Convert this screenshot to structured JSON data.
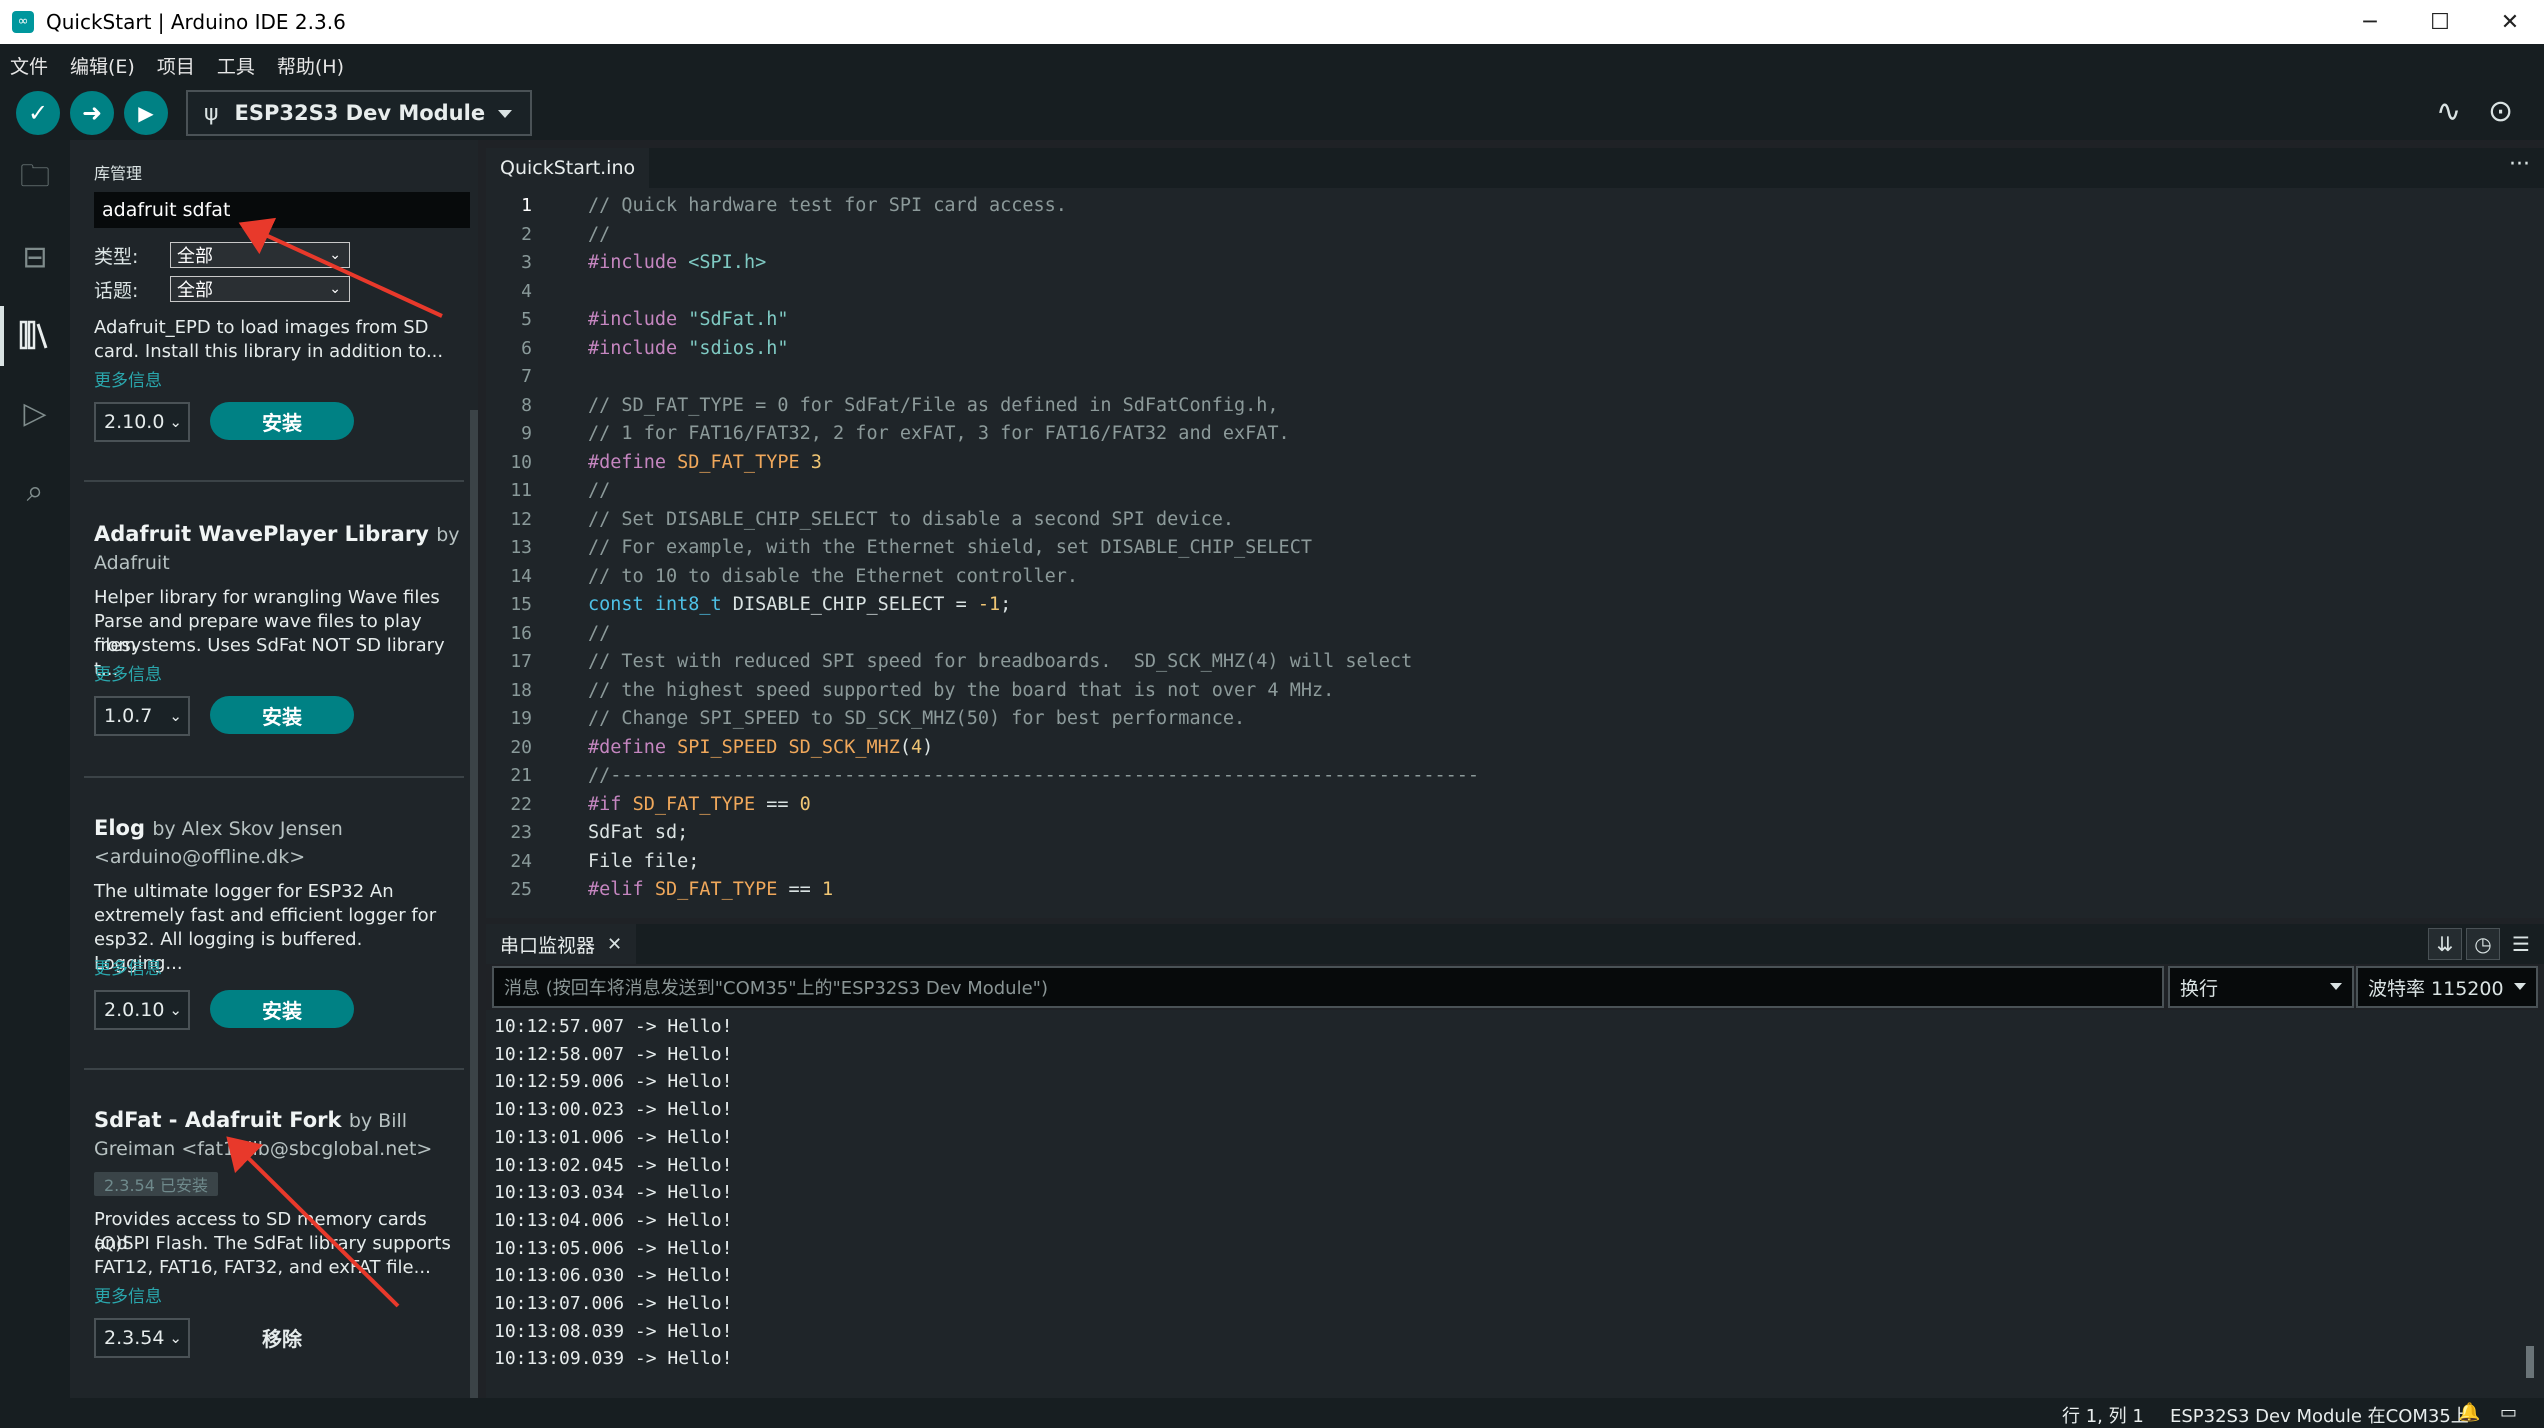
{
  "window": {
    "title": "QuickStart | Arduino IDE 2.3.6",
    "app_icon": "arduino-logo",
    "controls": [
      "minimize",
      "maximize",
      "close"
    ]
  },
  "menu": {
    "items": [
      "文件",
      "编辑(E)",
      "项目",
      "工具",
      "帮助(H)"
    ]
  },
  "toolbar": {
    "buttons": [
      "verify-icon",
      "upload-icon",
      "debug-icon"
    ],
    "board_name": "ESP32S3 Dev Module",
    "right_icons": [
      "serial-plotter-icon",
      "serial-monitor-icon"
    ]
  },
  "activity_bar": {
    "items": [
      "folder-icon",
      "boards-manager-icon",
      "library-manager-icon",
      "debug-icon",
      "search-icon"
    ],
    "active": "library-manager-icon"
  },
  "library_manager": {
    "title": "库管理",
    "search_value": "adafruit sdfat",
    "type_label": "类型:",
    "type_value": "全部",
    "topic_label": "话题:",
    "topic_value": "全部",
    "entries": [
      {
        "partial_text_1": "Adafruit_EPD to load images from SD",
        "partial_text_2": "card. Install this library in addition to...",
        "more": "更多信息",
        "version": "2.10.0",
        "action": "安装"
      },
      {
        "name": "Adafruit WavePlayer Library",
        "by": "by",
        "author": "Adafruit",
        "desc_1": "Helper library for wrangling Wave files",
        "desc_2": "Parse and prepare wave files to play from",
        "desc_3": "filesystems. Uses SdFat NOT SD library t...",
        "more": "更多信息",
        "version": "1.0.7",
        "action": "安装"
      },
      {
        "name": "Elog",
        "by": "by Alex Skov Jensen",
        "author": "<arduino@offline.dk>",
        "desc_1": "The ultimate logger for ESP32 An",
        "desc_2": "extremely fast and efficient logger for",
        "desc_3": "esp32. All logging is buffered. Logging...",
        "more": "更多信息",
        "version": "2.0.10",
        "action": "安装"
      },
      {
        "name": "SdFat - Adafruit Fork",
        "by": "by Bill",
        "author": "Greiman <fat16lib@sbcglobal.net>",
        "installed": "2.3.54 已安装",
        "desc_1": "Provides access to SD memory cards and",
        "desc_2": "(Q)SPI Flash. The SdFat library supports",
        "desc_3": "FAT12, FAT16, FAT32, and exFAT file...",
        "more": "更多信息",
        "version": "2.3.54",
        "action": "移除"
      }
    ]
  },
  "editor": {
    "tab": "QuickStart.ino",
    "more": "···",
    "current_line": 1,
    "lines": [
      "// Quick hardware test for SPI card access.",
      "//",
      "#include <SPI.h>",
      "",
      "#include \"SdFat.h\"",
      "#include \"sdios.h\"",
      "",
      "// SD_FAT_TYPE = 0 for SdFat/File as defined in SdFatConfig.h,",
      "// 1 for FAT16/FAT32, 2 for exFAT, 3 for FAT16/FAT32 and exFAT.",
      "#define SD_FAT_TYPE 3",
      "//",
      "// Set DISABLE_CHIP_SELECT to disable a second SPI device.",
      "// For example, with the Ethernet shield, set DISABLE_CHIP_SELECT",
      "// to 10 to disable the Ethernet controller.",
      "const int8_t DISABLE_CHIP_SELECT = -1;",
      "//",
      "// Test with reduced SPI speed for breadboards.  SD_SCK_MHZ(4) will select",
      "// the highest speed supported by the board that is not over 4 MHz.",
      "// Change SPI_SPEED to SD_SCK_MHZ(50) for best performance.",
      "#define SPI_SPEED SD_SCK_MHZ(4)",
      "//------------------------------------------------------------------------------",
      "#if SD_FAT_TYPE == 0",
      "SdFat sd;",
      "File file;",
      "#elif SD_FAT_TYPE == 1"
    ]
  },
  "serial_monitor": {
    "tab": "串口监视器",
    "close": "✕",
    "message_placeholder": "消息 (按回车将消息发送到\"COM35\"上的\"ESP32S3 Dev Module\")",
    "line_ending": "换行",
    "baud": "波特率 115200",
    "icons": [
      "autoscroll-icon",
      "timestamp-icon",
      "clear-output-icon"
    ],
    "output": [
      "10:12:57.007 -> Hello!",
      "10:12:58.007 -> Hello!",
      "10:12:59.006 -> Hello!",
      "10:13:00.023 -> Hello!",
      "10:13:01.006 -> Hello!",
      "10:13:02.045 -> Hello!",
      "10:13:03.034 -> Hello!",
      "10:13:04.006 -> Hello!",
      "10:13:05.006 -> Hello!",
      "10:13:06.030 -> Hello!",
      "10:13:07.006 -> Hello!",
      "10:13:08.039 -> Hello!",
      "10:13:09.039 -> Hello!"
    ]
  },
  "status_bar": {
    "position": "行 1, 列 1",
    "board_port": "ESP32S3 Dev Module 在COM35上",
    "icons": [
      "notification-icon",
      "output-panel-icon"
    ]
  },
  "colors": {
    "teal_accent": "#008184",
    "annotation_arrow": "#e8392b",
    "background": "#1f2529"
  }
}
